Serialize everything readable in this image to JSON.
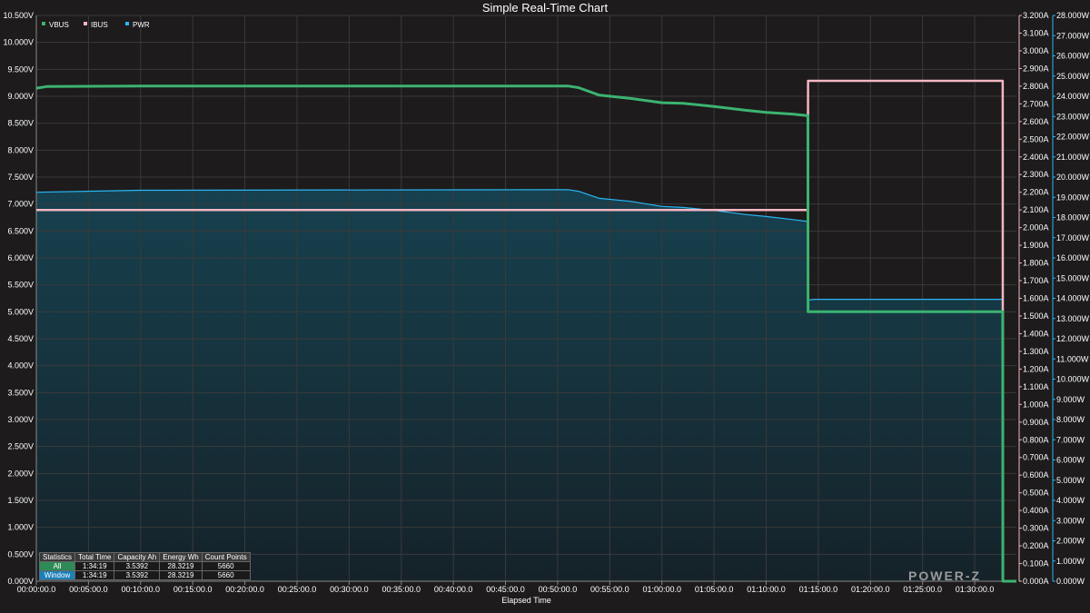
{
  "chart_data": {
    "type": "line",
    "title": "Simple Real-Time Chart",
    "xlabel": "Elapsed Time",
    "x_unit": "seconds",
    "xlim": [
      0,
      5640
    ],
    "x_ticks": [
      "00:00:00.0",
      "00:05:00.0",
      "00:10:00.0",
      "00:15:00.0",
      "00:20:00.0",
      "00:25:00.0",
      "00:30:00.0",
      "00:35:00.0",
      "00:40:00.0",
      "00:45:00.0",
      "00:50:00.0",
      "00:55:00.0",
      "01:00:00.0",
      "01:05:00.0",
      "01:10:00.0",
      "01:15:00.0",
      "01:20:00.0",
      "01:25:00.0",
      "01:30:00.0"
    ],
    "y_left": {
      "unit": "V",
      "ylim": [
        0,
        10.5
      ],
      "ticks": [
        "0.000V",
        "0.500V",
        "1.000V",
        "1.500V",
        "2.000V",
        "2.500V",
        "3.000V",
        "3.500V",
        "4.000V",
        "4.500V",
        "5.000V",
        "5.500V",
        "6.000V",
        "6.500V",
        "7.000V",
        "7.500V",
        "8.000V",
        "8.500V",
        "9.000V",
        "9.500V",
        "10.000V",
        "10.500V"
      ]
    },
    "y_right_current": {
      "unit": "A",
      "ylim": [
        0,
        3.2
      ],
      "ticks": [
        "0.000A",
        "0.100A",
        "0.200A",
        "0.300A",
        "0.400A",
        "0.500A",
        "0.600A",
        "0.700A",
        "0.800A",
        "0.900A",
        "1.000A",
        "1.100A",
        "1.200A",
        "1.300A",
        "1.400A",
        "1.500A",
        "1.600A",
        "1.700A",
        "1.800A",
        "1.900A",
        "2.000A",
        "2.100A",
        "2.200A",
        "2.300A",
        "2.400A",
        "2.500A",
        "2.600A",
        "2.700A",
        "2.800A",
        "2.900A",
        "3.000A",
        "3.100A",
        "3.200A"
      ]
    },
    "y_right_power": {
      "unit": "W",
      "ylim": [
        0,
        28.0
      ],
      "ticks": [
        "0.000W",
        "1.000W",
        "2.000W",
        "3.000W",
        "4.000W",
        "5.000W",
        "6.000W",
        "7.000W",
        "8.000W",
        "9.000W",
        "10.000W",
        "11.000W",
        "12.000W",
        "13.000W",
        "14.000W",
        "15.000W",
        "16.000W",
        "17.000W",
        "18.000W",
        "19.000W",
        "20.000W",
        "21.000W",
        "22.000W",
        "23.000W",
        "24.000W",
        "25.000W",
        "26.000W",
        "27.000W",
        "28.000W"
      ]
    },
    "grid": true,
    "legend_placement": "top-left",
    "series": [
      {
        "name": "VBUS",
        "axis": "left",
        "color": "#3cb371",
        "x": [
          0,
          60,
          600,
          3060,
          3120,
          3240,
          3420,
          3600,
          3720,
          3900,
          4080,
          4200,
          4350,
          4440,
          4441,
          5561,
          5562,
          5640
        ],
        "y": [
          9.15,
          9.18,
          9.19,
          9.19,
          9.16,
          9.02,
          8.96,
          8.88,
          8.87,
          8.81,
          8.74,
          8.7,
          8.67,
          8.64,
          5.0,
          5.0,
          0.0,
          0.0
        ]
      },
      {
        "name": "IBUS",
        "axis": "current",
        "color": "#f4b6c2",
        "x": [
          0,
          4440,
          4441,
          5561,
          5562,
          5640
        ],
        "y": [
          2.1,
          2.1,
          2.83,
          2.83,
          0.0,
          0.0
        ]
      },
      {
        "name": "PWR",
        "axis": "power",
        "color": "#29b6f6",
        "fill": true,
        "x": [
          0,
          600,
          3060,
          3120,
          3240,
          3420,
          3600,
          3720,
          3900,
          4080,
          4200,
          4350,
          4440,
          4441,
          4470,
          5561,
          5562,
          5640
        ],
        "y": [
          19.25,
          19.35,
          19.38,
          19.3,
          18.95,
          18.8,
          18.55,
          18.5,
          18.35,
          18.15,
          18.05,
          17.9,
          17.8,
          13.9,
          13.95,
          13.95,
          0.0,
          0.0
        ]
      }
    ]
  },
  "statistics": {
    "headers": [
      "Statistics",
      "Total Time",
      "Capacity Ah",
      "Energy Wh",
      "Count Points"
    ],
    "rows": [
      {
        "label": "All",
        "total_time": "1:34:19",
        "capacity_ah": "3.5392",
        "energy_wh": "28.3219",
        "count_points": "5660"
      },
      {
        "label": "Window",
        "total_time": "1:34:19",
        "capacity_ah": "3.5392",
        "energy_wh": "28.3219",
        "count_points": "5660"
      }
    ]
  },
  "watermark": "POWER-Z",
  "colors": {
    "background": "#1d1b1b",
    "plot_background": "#1d1b1b",
    "grid": "#3a3a3a",
    "fill_top": "#17414f",
    "fill_bottom": "#152229"
  }
}
